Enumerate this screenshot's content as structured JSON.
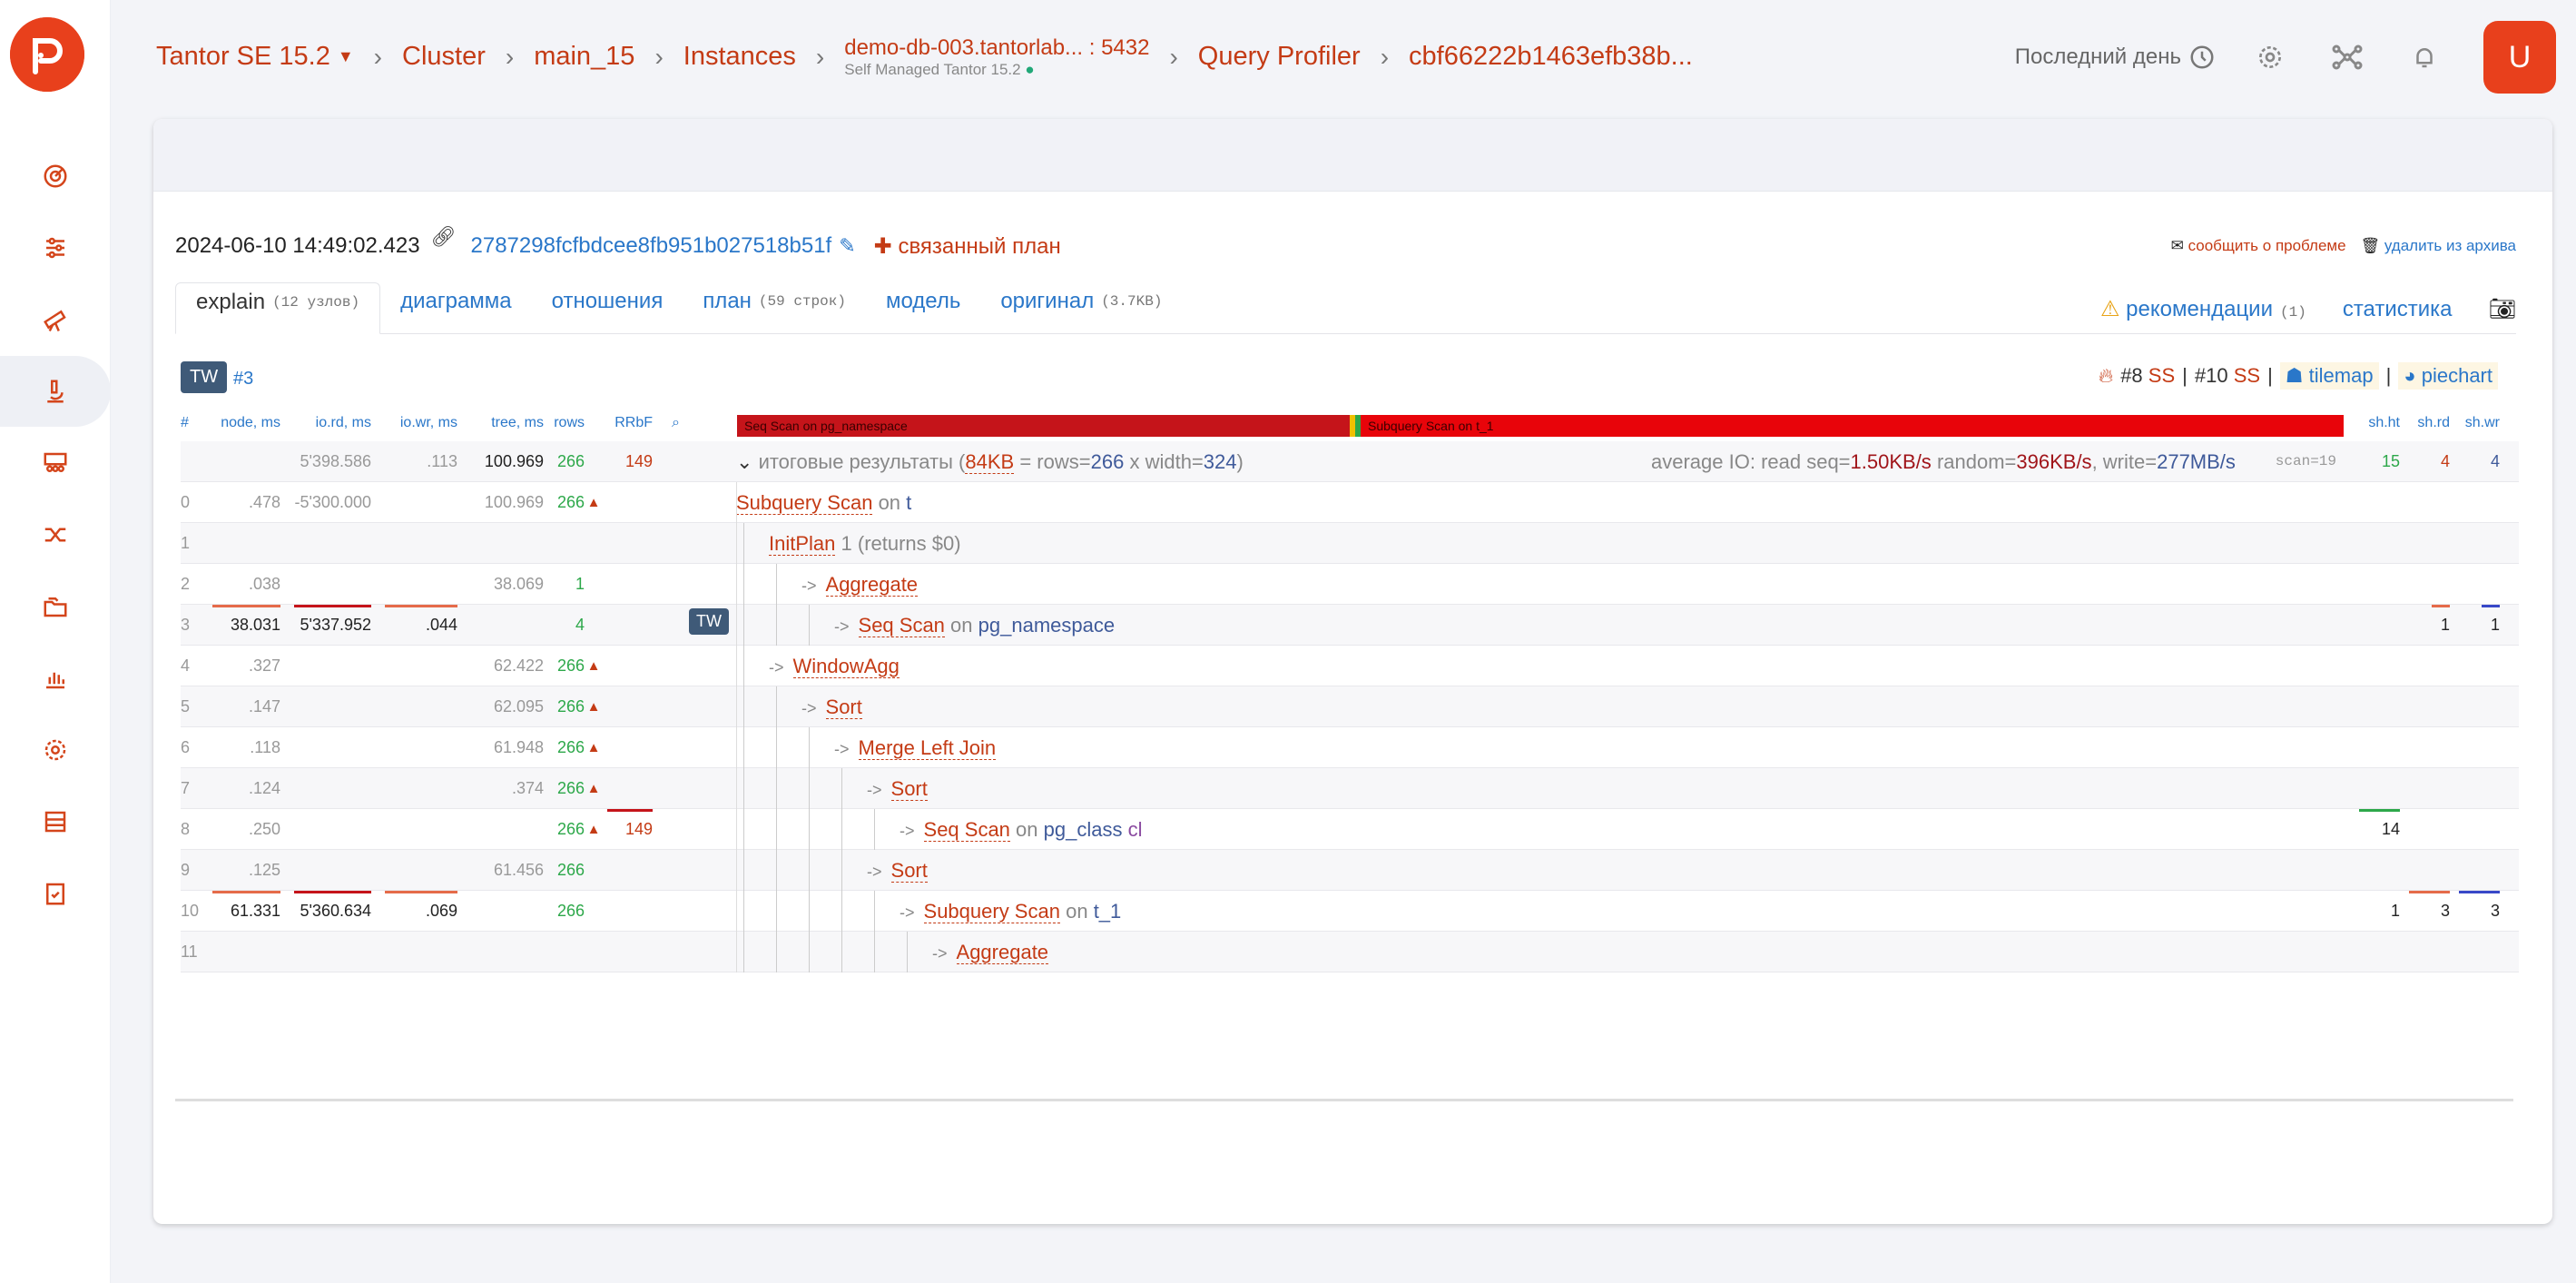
{
  "breadcrumbs": {
    "product": "Tantor SE 15.2",
    "cluster": "Cluster",
    "main": "main_15",
    "instances": "Instances",
    "db_host": "demo-db-003.tantorlab... : 5432",
    "db_sub": "Self Managed Tantor 15.2",
    "profiler": "Query Profiler",
    "query_id": "cbf66222b1463efb38b..."
  },
  "top": {
    "period": "Последний день",
    "avatar": "U"
  },
  "plan": {
    "date": "2024-06-10 14:49:02.423",
    "hash": "2787298fcfbdcee8fb951b027518b51f",
    "related": "связанный план",
    "report": "сообщить о проблеме",
    "delete": "удалить из архива"
  },
  "tabs": [
    {
      "label": "explain",
      "note": "(12 узлов)"
    },
    {
      "label": "диаграмма",
      "note": ""
    },
    {
      "label": "отношения",
      "note": ""
    },
    {
      "label": "план",
      "note": "(59 строк)"
    },
    {
      "label": "модель",
      "note": ""
    },
    {
      "label": "оригинал",
      "note": "(3.7KB)"
    }
  ],
  "tabs_right": {
    "recs": "рекомендации",
    "recs_count": "(1)",
    "stats": "статистика"
  },
  "toolbar": {
    "tw": "TW",
    "node_ref": "#3",
    "ss8": "#8",
    "ss10": "#10",
    "ss": "SS",
    "tilemap": "tilemap",
    "piechart": "piechart"
  },
  "headers": {
    "num": "#",
    "node": "node, ms",
    "iord": "io.rd, ms",
    "iowr": "io.wr, ms",
    "tree": "tree, ms",
    "rows": "rows",
    "rrbf": "RRbF",
    "shht": "sh.ht",
    "shrd": "sh.rd",
    "shwr": "sh.wr"
  },
  "gantt": {
    "seg1": "Seq Scan on pg_namespace",
    "seg2": "Subquery Scan on t_1"
  },
  "summary": {
    "iord": "5'398.586",
    "iowr": ".113",
    "tree": "100.969",
    "rows": "266",
    "rrbf": "149",
    "label": "итоговые результаты",
    "size": "84KB",
    "eq": "= rows=",
    "rows2": "266",
    "x": "x width=",
    "width": "324",
    "io_label": "average IO: read seq=",
    "seq": "1.50KB/s",
    "random_label": "random=",
    "random": "396KB/s",
    "write_label": "write=",
    "write": "277MB/s",
    "scan": "scan=19",
    "shht": "15",
    "shrd": "4",
    "shwr": "4"
  },
  "rows": [
    {
      "n": "0",
      "node": ".478",
      "iord": "-5'300.000",
      "iowr": "",
      "tree": "100.969",
      "rows": "266",
      "up": "▲",
      "rrbf": "",
      "op": "Subquery Scan",
      "on": "on",
      "rel": "t",
      "alias": "",
      "cond": "",
      "shht": "",
      "shrd": "",
      "shwr": ""
    },
    {
      "n": "1",
      "node": "",
      "iord": "",
      "iowr": "",
      "tree": "",
      "rows": "",
      "up": "",
      "rrbf": "",
      "op": "InitPlan",
      "on": "",
      "rel": "",
      "alias": "",
      "cond": "1 (returns $0)",
      "shht": "",
      "shrd": "",
      "shwr": ""
    },
    {
      "n": "2",
      "node": ".038",
      "iord": "",
      "iowr": "",
      "tree": "38.069",
      "rows": "1",
      "up": "",
      "rrbf": "",
      "op": "Aggregate",
      "on": "",
      "rel": "",
      "alias": "",
      "cond": "",
      "shht": "",
      "shrd": "",
      "shwr": ""
    },
    {
      "n": "3",
      "node": "38.031",
      "iord": "5'337.952",
      "iowr": ".044",
      "tree": "",
      "rows": "4",
      "up": "",
      "rrbf": "",
      "op": "Seq Scan",
      "on": "on",
      "rel": "pg_namespace",
      "alias": "",
      "cond": "",
      "shht": "",
      "shrd": "1",
      "shwr": "1"
    },
    {
      "n": "4",
      "node": ".327",
      "iord": "",
      "iowr": "",
      "tree": "62.422",
      "rows": "266",
      "up": "▲",
      "rrbf": "",
      "op": "WindowAgg",
      "on": "",
      "rel": "",
      "alias": "",
      "cond": "",
      "shht": "",
      "shrd": "",
      "shwr": ""
    },
    {
      "n": "5",
      "node": ".147",
      "iord": "",
      "iowr": "",
      "tree": "62.095",
      "rows": "266",
      "up": "▲",
      "rrbf": "",
      "op": "Sort",
      "on": "",
      "rel": "",
      "alias": "",
      "cond": "",
      "shht": "",
      "shrd": "",
      "shwr": ""
    },
    {
      "n": "6",
      "node": ".118",
      "iord": "",
      "iowr": "",
      "tree": "61.948",
      "rows": "266",
      "up": "▲",
      "rrbf": "",
      "op": "Merge Left Join",
      "on": "",
      "rel": "",
      "alias": "",
      "cond": "",
      "shht": "",
      "shrd": "",
      "shwr": ""
    },
    {
      "n": "7",
      "node": ".124",
      "iord": "",
      "iowr": "",
      "tree": ".374",
      "rows": "266",
      "up": "▲",
      "rrbf": "",
      "op": "Sort",
      "on": "",
      "rel": "",
      "alias": "",
      "cond": "",
      "shht": "",
      "shrd": "",
      "shwr": ""
    },
    {
      "n": "8",
      "node": ".250",
      "iord": "",
      "iowr": "",
      "tree": "",
      "rows": "266",
      "up": "▲",
      "rrbf": "149",
      "op": "Seq Scan",
      "on": "on",
      "rel": "pg_class",
      "alias": "cl",
      "cond": "",
      "shht": "14",
      "shrd": "",
      "shwr": ""
    },
    {
      "n": "9",
      "node": ".125",
      "iord": "",
      "iowr": "",
      "tree": "61.456",
      "rows": "266",
      "up": "",
      "rrbf": "",
      "op": "Sort",
      "on": "",
      "rel": "",
      "alias": "",
      "cond": "",
      "shht": "",
      "shrd": "",
      "shwr": ""
    },
    {
      "n": "10",
      "node": "61.331",
      "iord": "5'360.634",
      "iowr": ".069",
      "tree": "",
      "rows": "266",
      "up": "",
      "rrbf": "",
      "op": "Subquery Scan",
      "on": "on",
      "rel": "t_1",
      "alias": "",
      "cond": "",
      "shht": "1",
      "shrd": "3",
      "shwr": "3"
    },
    {
      "n": "11",
      "node": "",
      "iord": "",
      "iowr": "",
      "tree": "",
      "rows": "",
      "up": "",
      "rrbf": "",
      "op": "Aggregate",
      "on": "",
      "rel": "",
      "alias": "",
      "cond": "",
      "shht": "",
      "shrd": "",
      "shwr": ""
    }
  ],
  "colors": {
    "accent": "#c43b15",
    "brand": "#e8401c",
    "link": "#2a77c9"
  }
}
